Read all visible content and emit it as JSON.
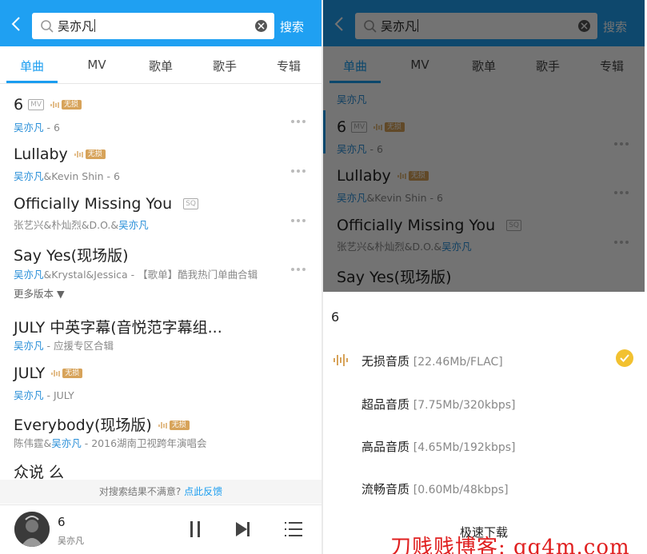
{
  "search": {
    "query": "吴亦凡",
    "button_label": "搜索"
  },
  "tabs": [
    {
      "label": "单曲",
      "active": true
    },
    {
      "label": "MV",
      "active": false
    },
    {
      "label": "歌单",
      "active": false
    },
    {
      "label": "歌手",
      "active": false
    },
    {
      "label": "专辑",
      "active": false
    }
  ],
  "songs": [
    {
      "title": "6",
      "artist": "吴亦凡",
      "extra": " - 6",
      "badges": [
        "MV",
        "无损"
      ]
    },
    {
      "title": "Lullaby",
      "artist": "吴亦凡",
      "extra": "&Kevin Shin - 6",
      "badges": [
        "无损"
      ]
    },
    {
      "title": "Officially Missing You",
      "artist_prefix": "张艺兴&朴灿烈&D.O.&",
      "artist": "吴亦凡",
      "extra": "",
      "badges": [
        "SQ"
      ]
    },
    {
      "title": "Say Yes(现场版)",
      "artist": "吴亦凡",
      "extra": "&Krystal&Jessica - 【歌单】酷我热门单曲合辑",
      "badges": []
    },
    {
      "title": "JULY 中英字幕(音悦范字幕组...",
      "artist": "吴亦凡",
      "extra": " - 应援专区合辑",
      "badges": []
    },
    {
      "title": "JULY",
      "artist": "吴亦凡",
      "extra": " - JULY",
      "badges": [
        "无损"
      ]
    },
    {
      "title": "Everybody(现场版)",
      "artist_prefix": "陈伟霆&",
      "artist": "吴亦凡",
      "extra": " - 2016湖南卫视跨年演唱会",
      "badges": [
        "无损"
      ]
    },
    {
      "title": "众说 么",
      "artist": "",
      "extra": "",
      "badges": []
    }
  ],
  "more_versions_label": "更多版本 ▼",
  "feedback": {
    "text": "对搜索结果不满意? ",
    "link": "点此反馈"
  },
  "player": {
    "title": "6",
    "artist": "吴亦凡"
  },
  "sheet": {
    "title": "6",
    "options": [
      {
        "label": "无损音质",
        "meta": "[22.46Mb/FLAC]",
        "selected": true
      },
      {
        "label": "超品音质",
        "meta": "[7.75Mb/320kbps]",
        "selected": false
      },
      {
        "label": "高品音质",
        "meta": "[4.65Mb/192kbps]",
        "selected": false
      },
      {
        "label": "流畅音质",
        "meta": "[0.60Mb/48kbps]",
        "selected": false
      }
    ],
    "action_label": "极速下载"
  },
  "watermark": "刀贱贱博客: qq4m.com",
  "colors": {
    "brand_blue": "#1fa0f2",
    "artist_blue": "#2a8fd8",
    "lossless_gold": "#d7a35a",
    "check_yellow": "#f2c130"
  }
}
